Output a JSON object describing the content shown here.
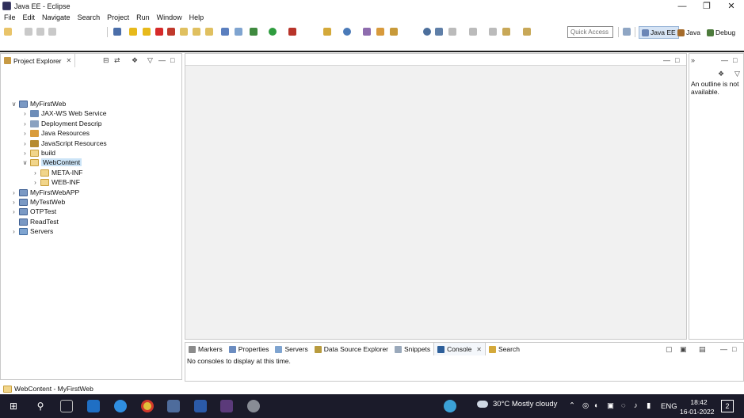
{
  "window": {
    "title": "Java EE - Eclipse"
  },
  "menu": [
    "File",
    "Edit",
    "Navigate",
    "Search",
    "Project",
    "Run",
    "Window",
    "Help"
  ],
  "toolbar": {
    "quick_access_placeholder": "Quick Access"
  },
  "perspectives": [
    {
      "label": "Java EE",
      "active": true
    },
    {
      "label": "Java",
      "active": false
    },
    {
      "label": "Debug",
      "active": false
    }
  ],
  "project_explorer": {
    "tab_label": "Project Explorer",
    "tree": [
      {
        "label": "MyFirstWeb",
        "level": 0,
        "expanded": true,
        "icon": "project-icon"
      },
      {
        "label": "JAX-WS Web Service",
        "level": 1,
        "expanded": false,
        "icon": "webservice-icon"
      },
      {
        "label": "Deployment Descrip",
        "level": 1,
        "expanded": false,
        "icon": "deployment-descriptor-icon"
      },
      {
        "label": "Java Resources",
        "level": 1,
        "expanded": false,
        "icon": "java-resources-icon"
      },
      {
        "label": "JavaScript Resources",
        "level": 1,
        "expanded": false,
        "icon": "javascript-resources-icon"
      },
      {
        "label": "build",
        "level": 1,
        "expanded": false,
        "icon": "folder-icon"
      },
      {
        "label": "WebContent",
        "level": 1,
        "expanded": true,
        "selected": true,
        "icon": "folder-icon"
      },
      {
        "label": "META-INF",
        "level": 2,
        "expanded": false,
        "icon": "folder-icon"
      },
      {
        "label": "WEB-INF",
        "level": 2,
        "expanded": false,
        "icon": "folder-icon"
      },
      {
        "label": "MyFirstWebAPP",
        "level": 0,
        "expanded": false,
        "icon": "project-icon"
      },
      {
        "label": "MyTestWeb",
        "level": 0,
        "expanded": false,
        "icon": "project-icon"
      },
      {
        "label": "OTPTest",
        "level": 0,
        "expanded": false,
        "icon": "project-icon"
      },
      {
        "label": "ReadTest",
        "level": 0,
        "expanded": null,
        "icon": "project-icon"
      },
      {
        "label": "Servers",
        "level": 0,
        "expanded": false,
        "icon": "servers-icon"
      }
    ]
  },
  "outline": {
    "message": "An outline is not available."
  },
  "bottom_tabs": [
    "Markers",
    "Properties",
    "Servers",
    "Data Source Explorer",
    "Snippets",
    "Console",
    "Search"
  ],
  "console": {
    "active_tab": "Console",
    "message": "No consoles to display at this time."
  },
  "status": {
    "text": "WebContent - MyFirstWeb"
  },
  "taskbar": {
    "weather": "30°C  Mostly cloudy",
    "language": "ENG",
    "time": "18:42",
    "date": "16-01-2022",
    "notification_count": "2"
  }
}
